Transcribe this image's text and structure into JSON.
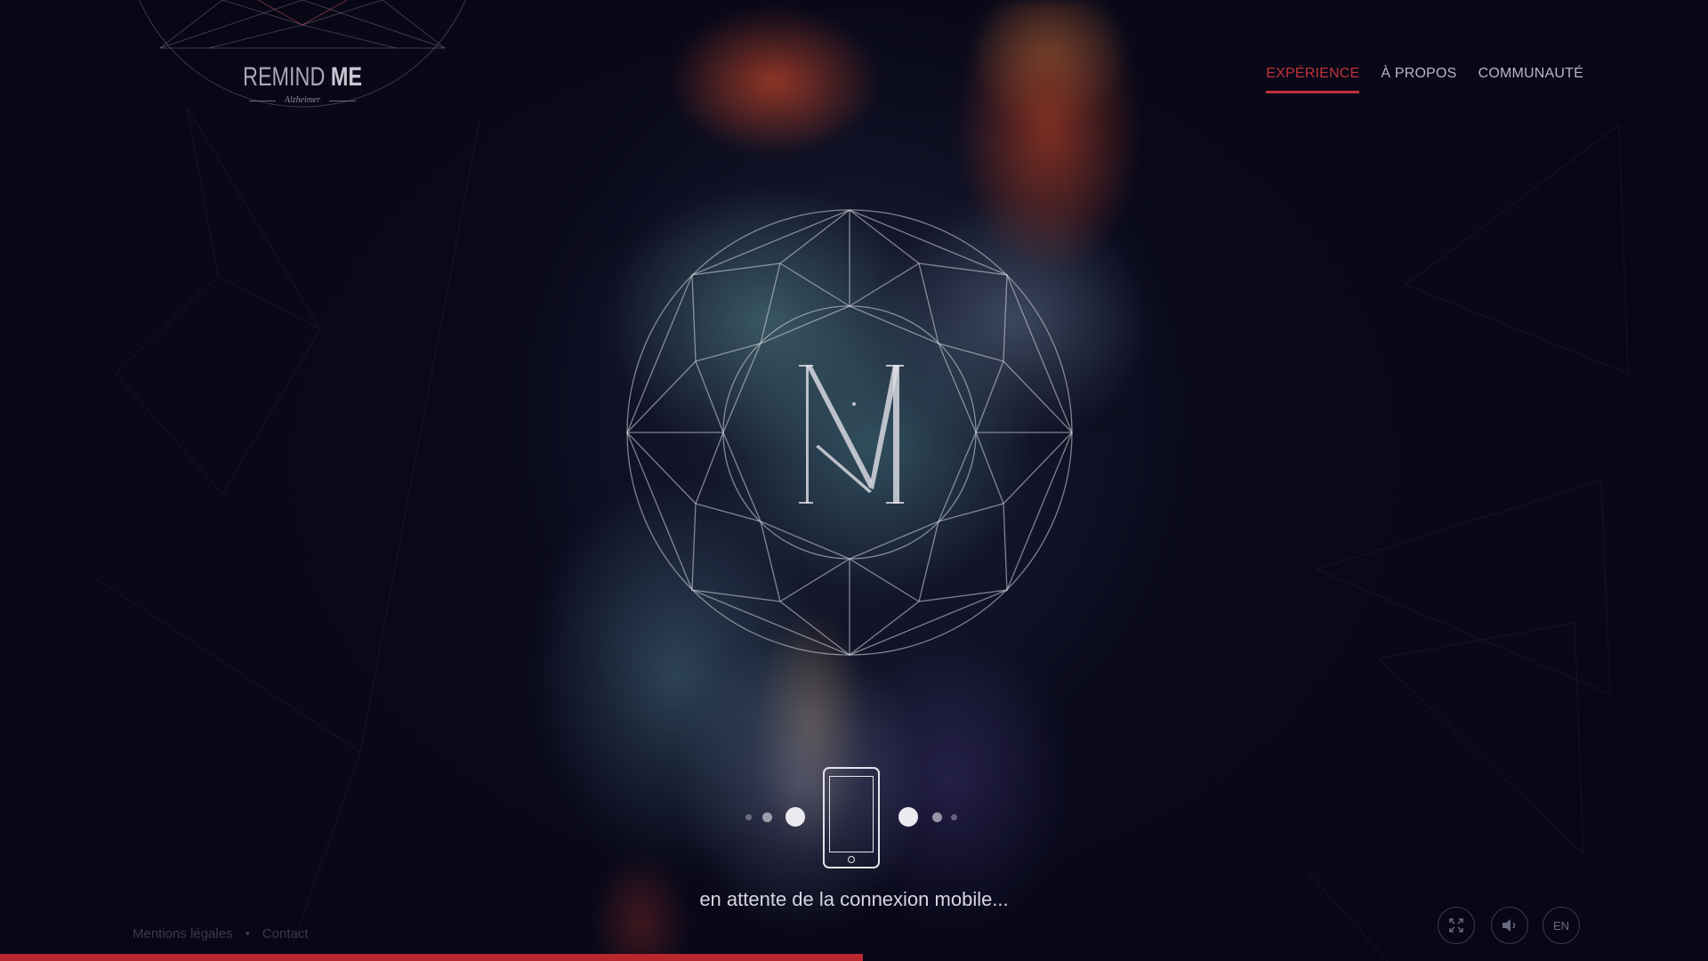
{
  "logo": {
    "title_light": "REMIND ",
    "title_bold": "ME",
    "subtitle": "Alzheimer"
  },
  "nav": {
    "items": [
      {
        "label": "EXPÉRIENCE",
        "active": true
      },
      {
        "label": "À PROPOS",
        "active": false
      },
      {
        "label": "COMMUNAUTÉ",
        "active": false
      }
    ]
  },
  "center_emblem": {
    "icon": "m-monogram-icon"
  },
  "connection": {
    "status_text": "en attente de la connexion mobile...",
    "icon": "smartphone-icon"
  },
  "footer": {
    "legal_label": "Mentions légales",
    "separator": "•",
    "contact_label": "Contact"
  },
  "controls": {
    "fullscreen_icon": "fullscreen-icon",
    "sound_icon": "speaker-icon",
    "language_label": "EN"
  },
  "progress": {
    "fraction": 0.505
  },
  "colors": {
    "accent": "#c0323c",
    "background": "#0a0a1c",
    "progress": "#b8282e"
  }
}
